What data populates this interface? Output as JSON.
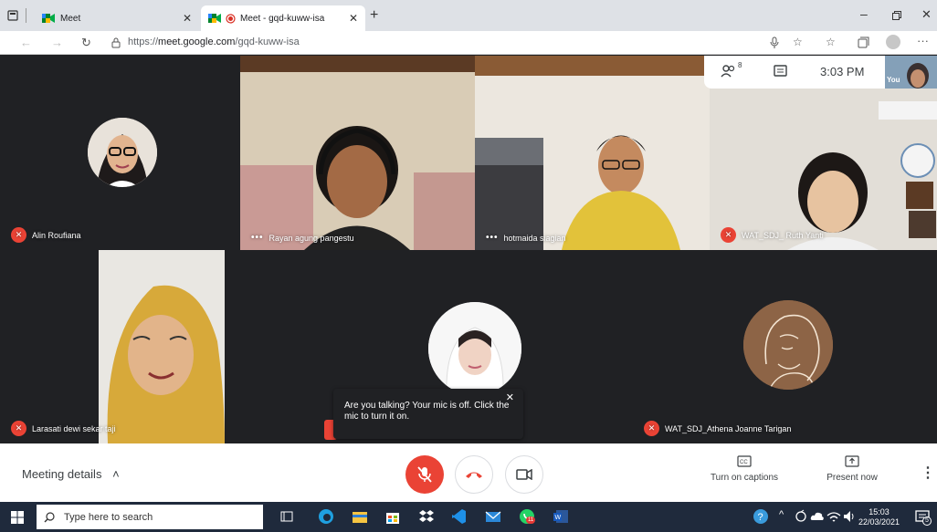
{
  "browser": {
    "tabs": [
      {
        "label": "Meet"
      },
      {
        "label": "Meet - gqd-kuww-isa"
      }
    ],
    "url_prefix": "https://",
    "url_domain": "meet.google.com",
    "url_path": "/gqd-kuww-isa"
  },
  "meet": {
    "participants_count": "8",
    "clock": "3:03 PM",
    "self_label": "You",
    "tiles": [
      {
        "name": "Alin Roufiana"
      },
      {
        "name": "Rayan agung pangestu"
      },
      {
        "name": "hotmaida siagian"
      },
      {
        "name": "WAT_SDJ_ Ruth Yanti"
      },
      {
        "name": "Larasati dewi sekar taji"
      },
      {
        "name": "WAT_SDJ_Athena Joanne Tarigan"
      }
    ],
    "tooltip": "Are you talking? Your mic is off. Click the mic to turn it on.",
    "meeting_details": "Meeting details",
    "captions_label": "Turn on captions",
    "present_label": "Present now"
  },
  "taskbar": {
    "search_placeholder": "Type here to search",
    "time": "15:03",
    "date": "22/03/2021",
    "notif_count": "5",
    "whatsapp_badge": "11"
  },
  "colors": {
    "red": "#ea4335",
    "dark": "#202124"
  }
}
